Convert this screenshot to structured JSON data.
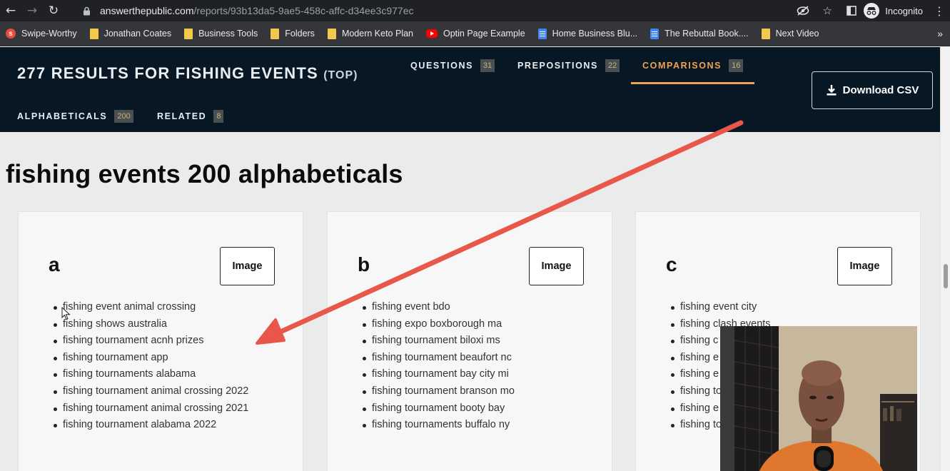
{
  "browser": {
    "url_host": "answerthepublic.com",
    "url_path": "/reports/93b13da5-9ae5-458c-affc-d34ee3c977ec",
    "profile_label": "Incognito"
  },
  "bookmarks": [
    {
      "label": "Swipe-Worthy",
      "icon": "swipe-icon"
    },
    {
      "label": "Jonathan Coates",
      "icon": "folder-icon"
    },
    {
      "label": "Business Tools",
      "icon": "folder-icon"
    },
    {
      "label": "Folders",
      "icon": "folder-icon"
    },
    {
      "label": "Modern Keto Plan",
      "icon": "folder-icon"
    },
    {
      "label": "Optin Page Example",
      "icon": "youtube-icon"
    },
    {
      "label": "Home Business Blu...",
      "icon": "doc-icon"
    },
    {
      "label": "The Rebuttal Book....",
      "icon": "doc-icon"
    },
    {
      "label": "Next Video",
      "icon": "folder-icon"
    }
  ],
  "header": {
    "title": "277 RESULTS FOR FISHING EVENTS",
    "title_suffix": "(TOP)",
    "tabs": [
      {
        "label": "QUESTIONS",
        "count": "31"
      },
      {
        "label": "PREPOSITIONS",
        "count": "22"
      },
      {
        "label": "COMPARISONS",
        "count": "16"
      },
      {
        "label": "ALPHABETICALS",
        "count": "200"
      },
      {
        "label": "RELATED",
        "count": "8"
      }
    ],
    "download_label": "Download CSV",
    "accent_color": "#f0a352"
  },
  "main": {
    "heading": "fishing events 200 alphabeticals",
    "image_button_label": "Image",
    "cards": [
      {
        "letter": "a",
        "items": [
          "fishing event animal crossing",
          "fishing shows australia",
          "fishing tournament acnh prizes",
          "fishing tournament app",
          "fishing tournaments alabama",
          "fishing tournament animal crossing 2022",
          "fishing tournament animal crossing 2021",
          "fishing tournament alabama 2022"
        ]
      },
      {
        "letter": "b",
        "items": [
          "fishing event bdo",
          "fishing expo boxborough ma",
          "fishing tournament biloxi ms",
          "fishing tournament beaufort nc",
          "fishing tournament bay city mi",
          "fishing tournament branson mo",
          "fishing tournament booty bay",
          "fishing tournaments buffalo ny"
        ]
      },
      {
        "letter": "c",
        "items": [
          "fishing event city",
          "fishing clash events",
          "fishing c",
          "fishing e",
          "fishing e",
          "fishing to",
          "fishing e",
          "fishing to"
        ]
      }
    ]
  },
  "annotation_arrow_color": "#e8574a"
}
